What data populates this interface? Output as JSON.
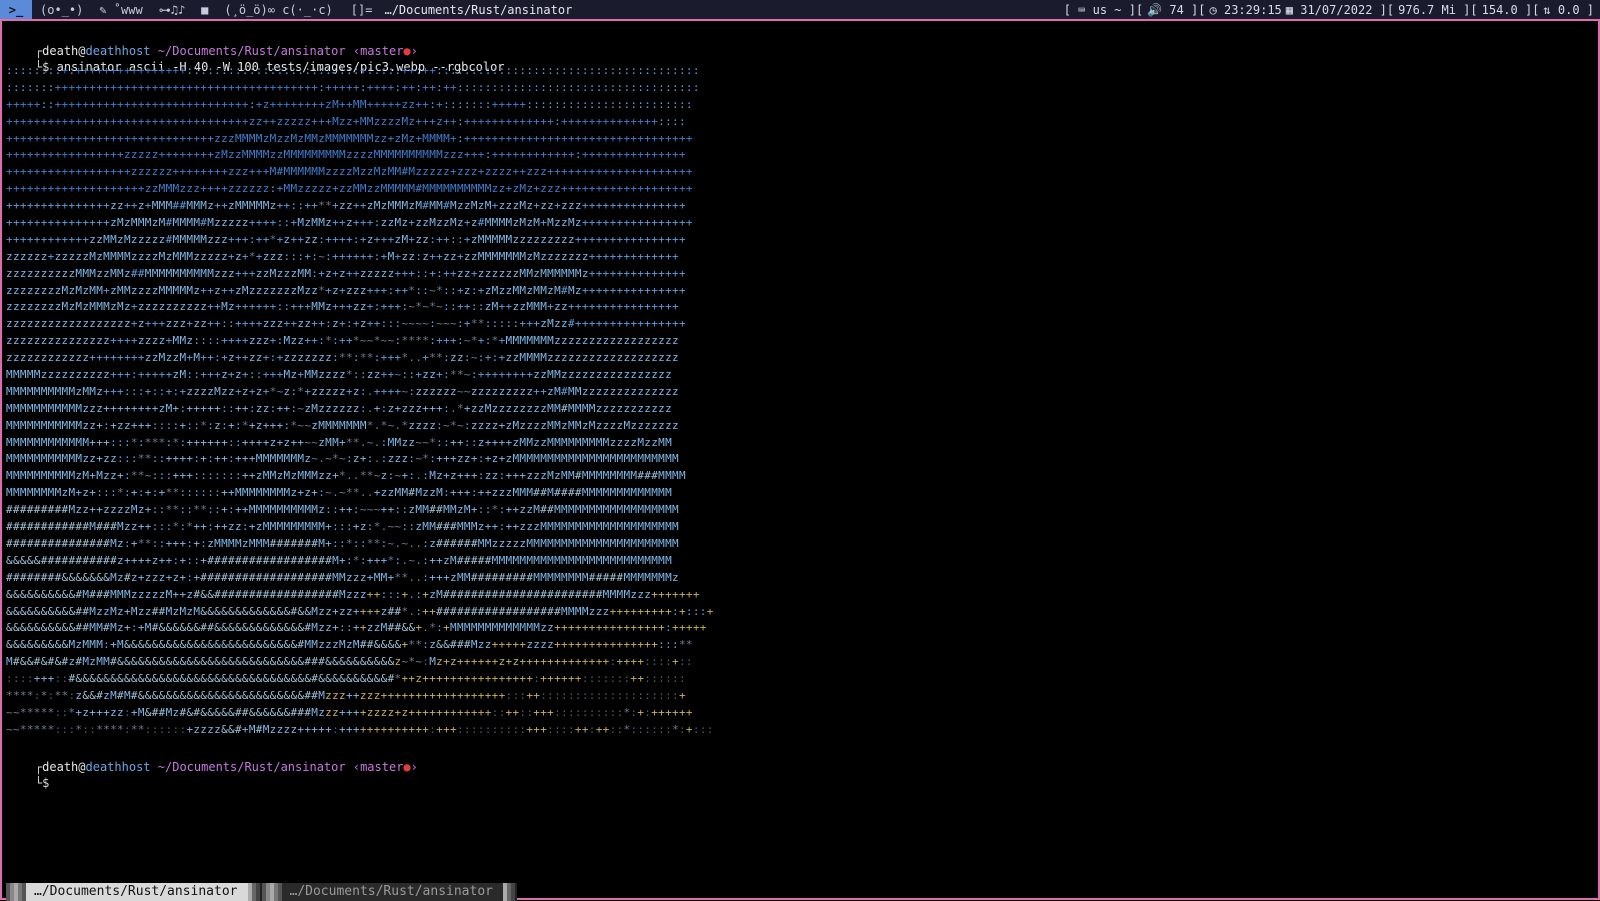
{
  "topbar": {
    "logo": ">_",
    "workspaces": [
      "(o•_•)",
      "✎ ˚www",
      "⊶♫♪",
      "■",
      "(¸ö_ö)∞ c(·_·c)"
    ],
    "layout": "[]=",
    "window_title": "…/Documents/Rust/ansinator",
    "status": {
      "keyboard": "[ ⌨ us ~ ][",
      "volume": "🔊 74 ][",
      "time": "◷ 23:29:15",
      "date": "▦ 31/07/2022 ][",
      "memory": "976.7 Mi ][",
      "cpu": "154.0 ][",
      "net": "⇅ 0.0 ]"
    }
  },
  "prompt1": {
    "corner": "┌",
    "user": "death",
    "at": "@",
    "host": "deathhost",
    "path": "~/Documents/Rust/ansinator",
    "branch_open": "‹master",
    "dot": "●",
    "branch_close": "›"
  },
  "command": {
    "prefix": "└$",
    "text": "ansinator ascii -H 40 -W 100 tests/images/pic3.webp --rgbcolor"
  },
  "ascii_art": {
    "rows": [
      "::::::::+:++++++++++++++++:::::::::::::::::::::::::+:::::++:++::::::::::::::::::::::::::::::::::::::",
      ":::::::++++++++++++++++++++++++++++++++++++++:+++++:++++:++:++:++:::::::::::::::::::::::::::::::::::",
      "+++++::++++++++++++++++++++++++++++:+z++++++++zM++MM+++++zz++:+:::::::+++++::::::::::::::::::::::::",
      "+++++++++++++++++++++++++++++++++++zz++zzzzz+++Mzz+MMzzzzMz+++z++:+++++++++++++:++++++++++++++::::",
      "++++++++++++++++++++++++++++++zzzMMMMzMzzMzMMzMMMMMMMzz+zMz+MMMM+:+++++++++++++++++++++++++++++++++",
      "+++++++++++++++++zzzzz++++++++zMzzMMMMzzMMMMMMMMMzzzzMMMMMMMMMMzzz+++:++++++++++++:+++++++++++++++",
      "++++++++++++++++++zzzzzz++++++++zzz+++M#MMMMMMzzzzMzzMzMM#Mzzzzz+zzz+zzzz++zzz+++++++++++++++++++++",
      "++++++++++++++++++++zzMMMzzz++++zzzzzz:+MMzzzzz+zzMMzzMMMMM#MMMMMMMMMMzz+zMz+zzz+++++++++++++++++++",
      "+++++++++++++++zz++z+MMM##MMMz++zMMMMMz++::++**+zz++zMzMMMzM#MM#MzzMzM+zzzMz+zz+zzz+++++++++++++++",
      "+++++++++++++++zMzMMMzM#MMMM#Mzzzzz++++::+MzMMz++z+++:zzMz+zzMzzMz+z#MMMMzMzM+MzzMz++++++++++++++++",
      "++++++++++++zzMMzMzzzzz#MMMMMzzz+++:++*+z++zz:++++:+z+++zM+zz:++::+zMMMMMzzzzzzzzz++++++++++++++++",
      "zzzzzz+zzzzzMzMMMMzzzzMzMMMzzzzz+z+*+zzz:::+:~:++++++:+M+zz:z++zz+zzMMMMMMMzMzzzzzzz+++++++++++++",
      "zzzzzzzzzzMMMzzMMz##MMMMMMMMMMzzz+++zzMzzzMM:+z+z++zzzzz+++::+:++zz+zzzzzzMMzMMMMMMz++++++++++++++",
      "zzzzzzzzMzMzMM+zMMzzzzMMMMMz++z++zMzzzzzzzMzz*+z+zzz+++:++*::~*::+z:+zMzzMMzMMzM#Mz+++++++++++++++",
      "zzzzzzzzMzMzMMMzMz+zzzzzzzzzz++Mz++++++::+++MMz+++zz+:+++:~*~*~::++::zM++zzMMM+zz++++++++++++++++",
      "zzzzzzzzzzzzzzzzzz+z+++zzz+zz++::++++zzz++zz++:z+:+z++:::~~~~:~~~:+**:::::+++zMzz#++++++++++++++++",
      "zzzzzzzzzzzzzzz++++zzzz+MMz::::++++zzz+:Mzz++:*:++*~~*~~:****:+++:~*+:*+MMMMMMMzzzzzzzzzzzzzzzzzz",
      "zzzzzzzzzzzz++++++++zzMzzM+M++:+z++zz+:+zzzzzzz:**:**:+++*..+**:zz:~:+:+zzMMMMzzzzzzzzzzzzzzzzzzz",
      "MMMMMzzzzzzzzzz+++:+++++zM::+++z+z+::+++Mz+MMzzzz*::zz++~::+zz+:**~:++++++++zzMMzzzzzzzzzzzzzzzz",
      "MMMMMMMMMMzMMz+++:::+::+:+zzzzMzz+z+z+*~z:*+zzzzz+z:.++++~:zzzzzz~~zzzzzzzzz++zM#MMzzzzzzzzzzzzzz",
      "MMMMMMMMMMMzzz++++++++zM+:+++++::++:zz:++:~zMzzzzzz:.+:z+zzz+++:.*+zzMzzzzzzzzMM#MMMMzzzzzzzzzzz",
      "MMMMMMMMMMMzz+:+zz+++::::+::*:z:+:*+z+++:*~~zMMMMMMM*.*~.*zzzz:~*~:zzzz+zMzzzzMMzMMzMzzzzMzzzzzzz",
      "MMMMMMMMMMMM+++:::*:***:*:++++++::++++z+z++~~zMM+**.~.:MMzz~~*::++::z++++zMMzzMMMMMMMMMzzzzMzzMM",
      "MMMMMMMMMMMzz+zz:::**::++++:+:++:+++MMMMMMMz~.~*~:z+:.:zzz:~*:+++zz+:+z+zMMMMMMMMMMMMMMMMMMMMMMMM",
      "MMMMMMMMMMzM+Mzz+:**~:::+++:::::::++zMMzMzMMMzz+*..**~z:~+:.:Mz+z+++:zz:+++zzzMzMM#MMMMMMMM###MMMM",
      "MMMMMMMMzM+z+:::*:+:+:+**::::::++MMMMMMMMz+z+:~.~**..+zzMM#MzzM:+++:++zzzMMM##M####MMMMMMMMMMMMM",
      "#########Mzz++zzzzMz+::**::**::+:++MMMMMMMMMMz::++:~~~++::zMM##MMzM+::*:++zzM##MMMMMMMMMMMMMMMMMM",
      "############M###Mzz++:::*:*++:++zz:+zMMMMMMMMM+:::+z:*.~~::zMM###MMMz++:++zzzMMMMMMMMMMMMMMMMMMMM",
      "###############Mz:+**::+++:+:zMMMMzMMM#######M+::*::**:~.~..:z######MMzzzzzMMMMMMMMMMMMMMMMMMMMMM",
      "&&&&&###########z++++z++:+::+##################M+:*:+++*:.~.:++zM#####MMMMMMMMMMMMMMMMMMMMMMMMMM",
      "########&&&&&&&Mz#z+zzz+z+:+###################MMzzz+MM+**..:+++zMM#########MMMMMMMM#####MMMMMMMz",
      "&&&&&&&&&&#M###MMMzzzzzM++z#&&##################Mzzz++:::+.:+zM#######################MMMMzzz+++++++",
      "&&&&&&&&&&##MzzMz+Mzz##MzMzM&&&&&&&&&&&&&#&&Mzz+zz++++z##*.:++##################MMMMzzz+++++++++:+:::+",
      "&&&&&&&&&&##MM#Mz+:+M#&&&&&&##&&&&&&&&&&&&&#Mzz+::++zzM##&&+.*:+MMMMMMMMMMMMMzz++++++++++++++++:+++++",
      "&&&&&&&&&MzMMM:+M&&&&&&&&&&&&&&&&&&&&&&&&&#MMzzzMzM##&&&&+**:z&&###Mzz+++++zzzz+++++++++++++++:::**",
      "M#&&#&#&#z#MzMM#&&&&&&&&&&&&&&&&&&&&&&&&&&&###&&&&&&&&&&z~*~:Mz+z++++++z+z+++++++++++++:++++::::+::",
      "::::+++::#&&&&&&&&&&&&&&&&&&&&&&&&&&&&&&&&&&#&&&&&&&&&&#*++z++++++++++++++++:++++++:::::::++::::::",
      "****:*:**:z&&#zM#M#&&&&&&&&&&&&&&&&&&&&&&&&##Mzzz++zzz++++++++++++++++++:::++::::::::::::::::::::+",
      "~~*****::*+z+++zz:+M&##Mz#&#&&&&&##&&&&&&###Mzzz++++zzzz+z++++++++++++::++::+++::::::::::*:+:++++++",
      "~~*****:::*::****:**::::::+zzzz&&#+M#Mzzzz+++++:+++++++++++++:+++::::::::::+++::::++:++::*::::::*:+:::"
    ],
    "palette": {
      "top": "#3f7fd0",
      "mid": "#5a9ee0",
      "light": "#7fb9ea",
      "dim": "#6b7f94",
      "pale": "#9fc3d8",
      "yellow": "#c8b15a",
      "dark": "#4a5a64"
    }
  },
  "prompt2": {
    "corner": "┌",
    "user": "death",
    "at": "@",
    "host": "deathhost",
    "path": "~/Documents/Rust/ansinator",
    "branch_open": "‹master",
    "dot": "●",
    "branch_close": "›"
  },
  "prompt2_tail": "└$",
  "tabs": [
    {
      "label": "…/Documents/Rust/ansinator",
      "active": true
    },
    {
      "label": "…/Documents/Rust/ansinator",
      "active": false
    }
  ]
}
